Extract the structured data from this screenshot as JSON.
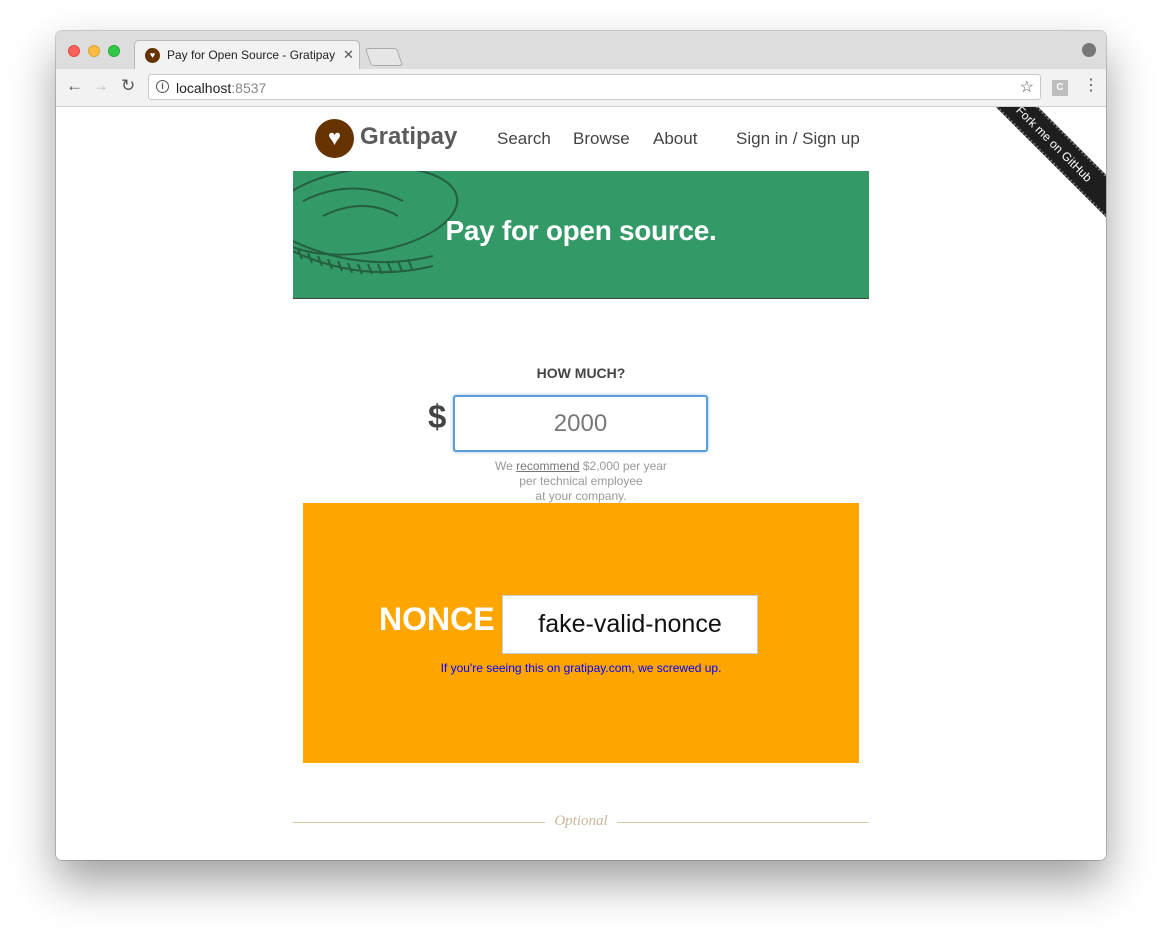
{
  "browser": {
    "tab_title": "Pay for Open Source - Gratipay",
    "tab_close": "✕",
    "url_host": "localhost",
    "url_port": ":8537",
    "ext_label": "C"
  },
  "site": {
    "logo_text": "Gratipay",
    "nav": {
      "search": "Search",
      "browse": "Browse",
      "about": "About",
      "signin": "Sign in / Sign up"
    },
    "fork_ribbon": "Fork me on GitHub"
  },
  "banner": {
    "title": "Pay for open source."
  },
  "payment": {
    "heading": "HOW MUCH?",
    "currency_symbol": "$",
    "amount_value": "2000",
    "recommend_prefix": "We ",
    "recommend_link": "recommend",
    "recommend_line1_suffix": " $2,000 per year",
    "recommend_line2": "per technical employee",
    "recommend_line3": "at your company."
  },
  "nonce": {
    "label": "NONCE",
    "value": "fake-valid-nonce",
    "note": "If you're seeing this on gratipay.com, we screwed up."
  },
  "optional": {
    "label": "Optional"
  },
  "colors": {
    "brand_brown": "#663300",
    "banner_green": "#339966",
    "nonce_orange": "#ffa500",
    "focus_blue": "#5b9dd9"
  }
}
